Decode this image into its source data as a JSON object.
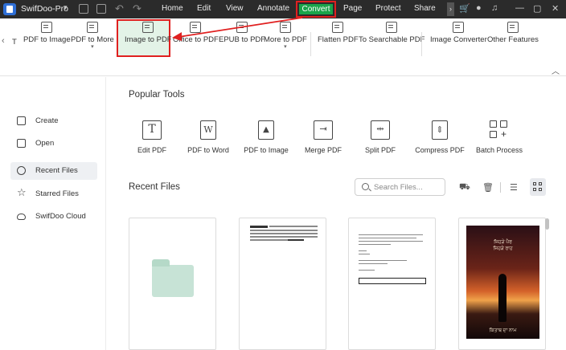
{
  "titlebar": {
    "app_name": "SwifDoo-Pro",
    "menu": [
      "Home",
      "Edit",
      "View",
      "Annotate",
      "Convert",
      "Page",
      "Protect",
      "Share"
    ],
    "active_menu": "Convert"
  },
  "ribbon": {
    "items": [
      {
        "label": "PDF to Image",
        "dropdown": false
      },
      {
        "label": "PDF to More",
        "dropdown": true
      },
      {
        "label": "Image to PDF",
        "dropdown": false
      },
      {
        "label": "Office to PDF",
        "dropdown": false
      },
      {
        "label": "EPUB to PDF",
        "dropdown": false
      },
      {
        "label": "More to PDF",
        "dropdown": true
      },
      {
        "label": "Flatten PDF",
        "dropdown": false
      },
      {
        "label": "To Searchable PDF",
        "dropdown": false
      },
      {
        "label": "Image Converter",
        "dropdown": false
      },
      {
        "label": "Other Features",
        "dropdown": false
      }
    ],
    "truncated_left_label": "T",
    "highlighted": "Image to PDF"
  },
  "sidebar": {
    "items": [
      {
        "label": "Create",
        "icon": "new-file-icon"
      },
      {
        "label": "Open",
        "icon": "folder-open-icon"
      },
      {
        "label": "Recent Files",
        "icon": "clock-icon"
      },
      {
        "label": "Starred Files",
        "icon": "star-icon"
      },
      {
        "label": "SwifDoo Cloud",
        "icon": "cloud-icon"
      }
    ],
    "active": "Recent Files"
  },
  "popular_tools": {
    "title": "Popular Tools",
    "items": [
      "Edit PDF",
      "PDF to Word",
      "PDF to Image",
      "Merge PDF",
      "Split PDF",
      "Compress PDF",
      "Batch Process"
    ]
  },
  "recent_files": {
    "title": "Recent Files",
    "search_placeholder": "Search Files...",
    "cover_text_top": "ਜਿਹੜੇ ਪੈਰ",
    "cover_text_sub": "ਜਿਹੜੇ ਰਾਹ",
    "cover_text_bottom": "ਕਿਤਾਬ ਦਾ ਨਾਮ"
  },
  "colors": {
    "titlebar_bg": "#2b2b2b",
    "accent_green": "#1aa44a",
    "highlight_red": "#e02020",
    "highlight_bg": "#e3f3e7"
  }
}
